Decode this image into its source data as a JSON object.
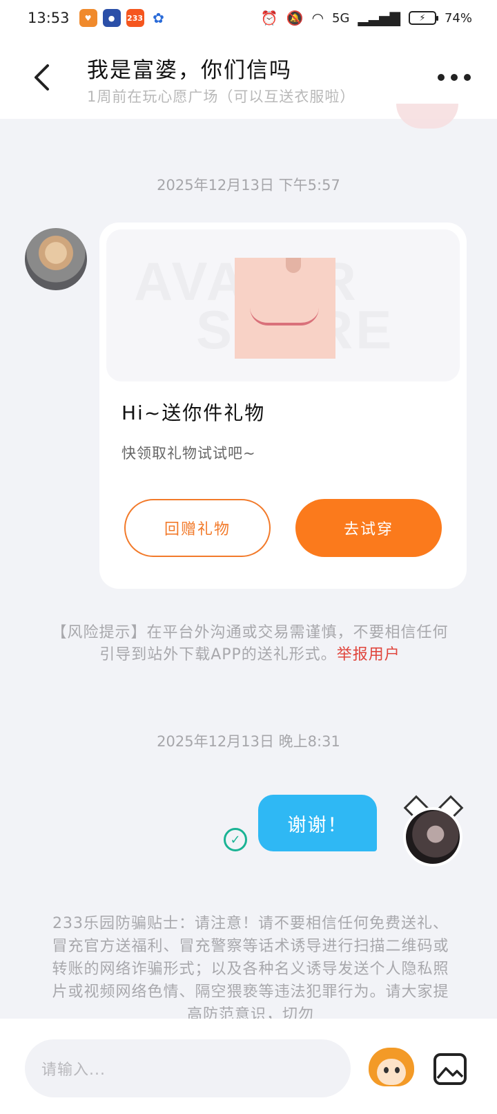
{
  "status_bar": {
    "time": "13:53",
    "app_badges": [
      "233"
    ],
    "network": "5G",
    "battery": "74%"
  },
  "header": {
    "title": "我是富婆，你们信吗",
    "subtitle": "1周前在玩心愿广场（可以互送衣服啦）"
  },
  "messages": {
    "timestamp_1": "2025年12月13日 下午5:57",
    "gift_card": {
      "title": "Hi~送你件礼物",
      "description": "快领取礼物试试吧~",
      "watermark_1": "AVATAR",
      "watermark_2": "STORE",
      "return_gift_label": "回赠礼物",
      "try_on_label": "去试穿"
    },
    "risk_notice": {
      "text": "【风险提示】在平台外沟通或交易需谨慎，不要相信任何引导到站外下载APP的送礼形式。",
      "report_label": "举报用户"
    },
    "timestamp_2": "2025年12月13日 晚上8:31",
    "outgoing_text": "谢谢！",
    "anti_fraud_tips": "233乐园防骗贴士：请注意！请不要相信任何免费送礼、冒充官方送福利、冒充警察等话术诱导进行扫描二维码或转账的网络诈骗形式；以及各种名义诱导发送个人隐私照片或视频网络色情、隔空猥亵等违法犯罪行为。请大家提高防范意识，切勿"
  },
  "input_bar": {
    "placeholder": "请输入..."
  },
  "colors": {
    "accent_orange": "#fb7a1c",
    "bubble_blue": "#2fb8f4",
    "report_red": "#e0453c",
    "sent_green": "#1ab394"
  }
}
